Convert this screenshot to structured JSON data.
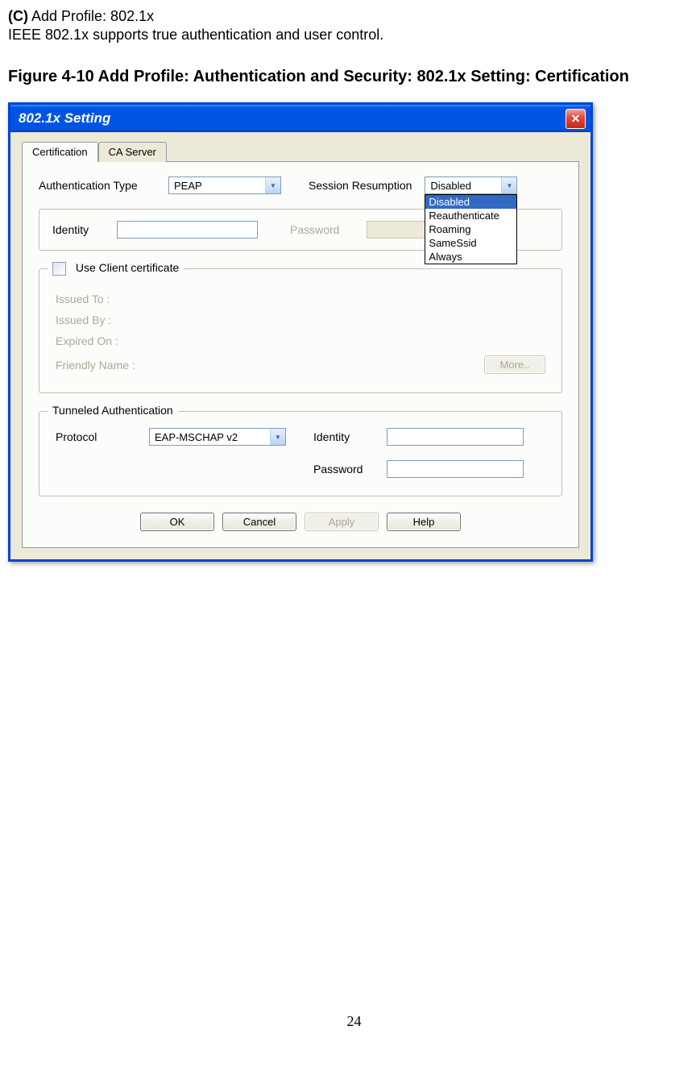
{
  "doc": {
    "heading_prefix": "(C)",
    "heading_text": " Add Profile: 802.1x",
    "subheading": "IEEE 802.1x supports true authentication and user control.",
    "figure_caption": "Figure 4-10 Add Profile: Authentication and Security: 802.1x Setting: Certification",
    "page_number": "24"
  },
  "dialog": {
    "title": "802.1x Setting",
    "close_glyph": "✕",
    "tabs": {
      "certification": "Certification",
      "ca_server": "CA Server"
    },
    "auth_type_label": "Authentication Type",
    "auth_type_value": "PEAP",
    "session_resumption_label": "Session Resumption",
    "session_resumption_value": "Disabled",
    "session_options": {
      "disabled": "Disabled",
      "reauthenticate": "Reauthenticate",
      "roaming": "Roaming",
      "samessid": "SameSsid",
      "always": "Always"
    },
    "identity_label": "Identity",
    "identity_value": "",
    "password_label": "Password",
    "password_value": "",
    "client_cert": {
      "checkbox_label": "Use Client certificate",
      "issued_to": "Issued To :",
      "issued_by": "Issued By :",
      "expired_on": "Expired On :",
      "friendly_name": "Friendly Name :",
      "more_btn": "More.."
    },
    "tunneled": {
      "legend": "Tunneled Authentication",
      "protocol_label": "Protocol",
      "protocol_value": "EAP-MSCHAP v2",
      "identity_label": "Identity",
      "identity_value": "",
      "password_label": "Password",
      "password_value": ""
    },
    "buttons": {
      "ok": "OK",
      "cancel": "Cancel",
      "apply": "Apply",
      "help": "Help"
    }
  }
}
